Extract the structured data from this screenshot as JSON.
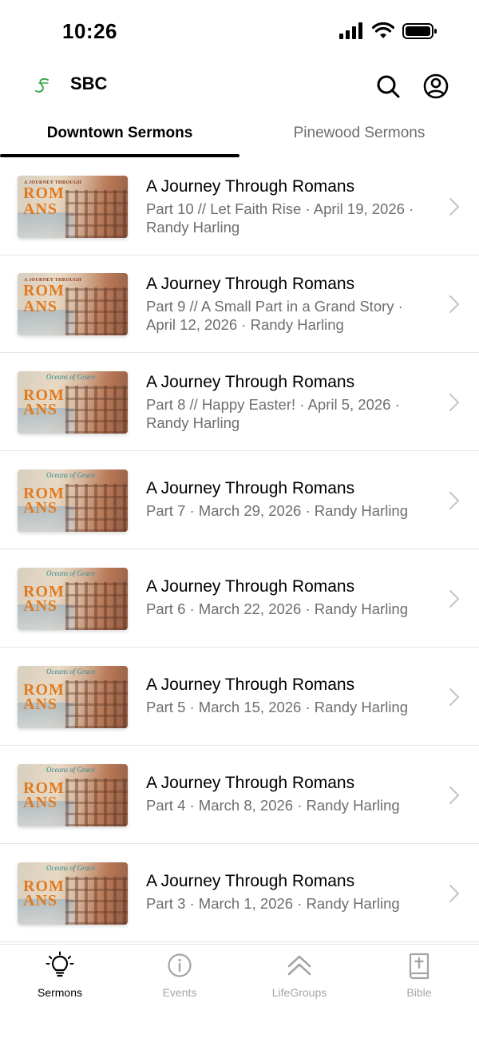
{
  "status_bar": {
    "time": "10:26"
  },
  "header": {
    "title": "SBC"
  },
  "tabs": [
    {
      "label": "Downtown Sermons"
    },
    {
      "label": "Pinewood Sermons"
    }
  ],
  "sermons": [
    {
      "title": "A Journey Through Romans",
      "subtitle": "Part 10 // Let Faith Rise · April 19, 2026 · Randy Harling"
    },
    {
      "title": "A Journey Through Romans",
      "subtitle": "Part 9 // A Small Part in a Grand Story · April 12, 2026 · Randy Harling"
    },
    {
      "title": "A Journey Through Romans",
      "subtitle": "Part 8 // Happy Easter! · April 5, 2026 · Randy Harling"
    },
    {
      "title": "A Journey Through Romans",
      "subtitle": "Part 7 · March 29, 2026 · Randy Harling"
    },
    {
      "title": "A Journey Through Romans",
      "subtitle": "Part 6 · March 22, 2026 · Randy Harling"
    },
    {
      "title": "A Journey Through Romans",
      "subtitle": "Part 5 · March 15, 2026 · Randy Harling"
    },
    {
      "title": "A Journey Through Romans",
      "subtitle": "Part 4 · March 8, 2026 · Randy Harling"
    },
    {
      "title": "A Journey Through Romans",
      "subtitle": "Part 3 · March 1, 2026 · Randy Harling"
    }
  ],
  "thumbnail": {
    "line1": "A JOURNEY THROUGH",
    "line2": "ROM",
    "line3": "ANS",
    "oceans": "Oceans of Grace"
  },
  "bottom_nav": [
    {
      "label": "Sermons",
      "icon": "lightbulb-icon"
    },
    {
      "label": "Events",
      "icon": "info-icon"
    },
    {
      "label": "LifeGroups",
      "icon": "double-chevron-up-icon"
    },
    {
      "label": "Bible",
      "icon": "bible-icon"
    }
  ],
  "colors": {
    "accent": "#000000",
    "inactive": "#a5a5a8",
    "subtitle": "#6e6e73",
    "logo": "#3aa84a"
  }
}
